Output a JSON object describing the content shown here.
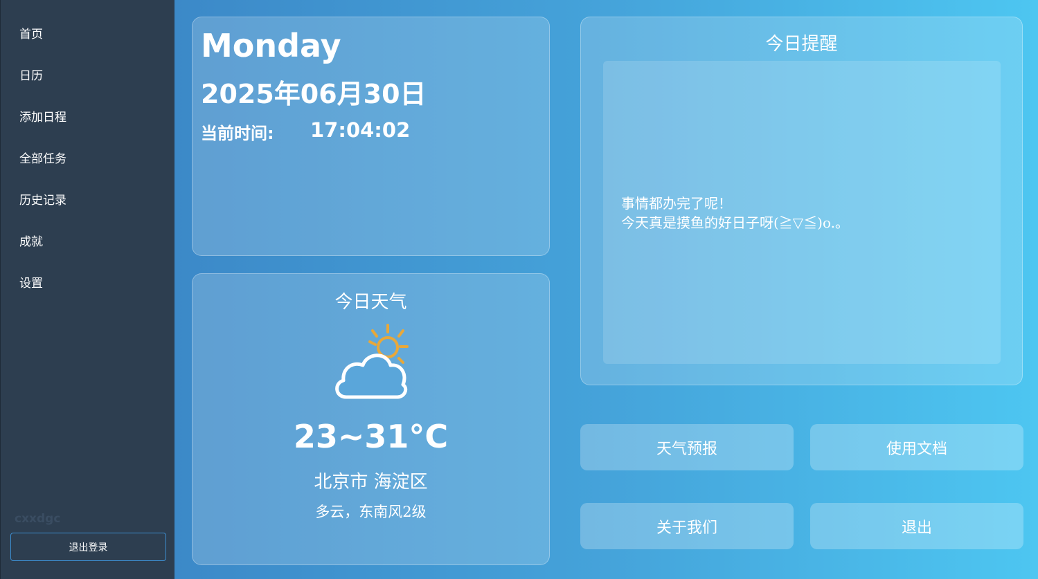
{
  "sidebar": {
    "items": [
      {
        "label": "首页"
      },
      {
        "label": "日历"
      },
      {
        "label": "添加日程"
      },
      {
        "label": "全部任务"
      },
      {
        "label": "历史记录"
      },
      {
        "label": "成就"
      },
      {
        "label": "设置"
      }
    ],
    "username": "cxxdgc",
    "logout_label": "退出登录"
  },
  "date_card": {
    "weekday": "Monday",
    "date": "2025年06月30日",
    "time_label": "当前时间:",
    "time_value": "17:04:02"
  },
  "weather": {
    "title": "今日天气",
    "icon": "partly-cloudy-icon",
    "temperature": "23~31°C",
    "location": "北京市 海淀区",
    "condition": "多云，东南风2级"
  },
  "reminder": {
    "title": "今日提醒",
    "text": "事情都办完了呢！\n今天真是摸鱼的好日子呀(≧▽≦)o.。"
  },
  "actions": {
    "weather_forecast": "天气预报",
    "docs": "使用文档",
    "about": "关于我们",
    "exit": "退出"
  },
  "colors": {
    "sidebar_bg": "#2d3e50",
    "gradient_start": "#3c89c8",
    "gradient_end": "#4dc6f1",
    "sun": "#e8a83a"
  }
}
